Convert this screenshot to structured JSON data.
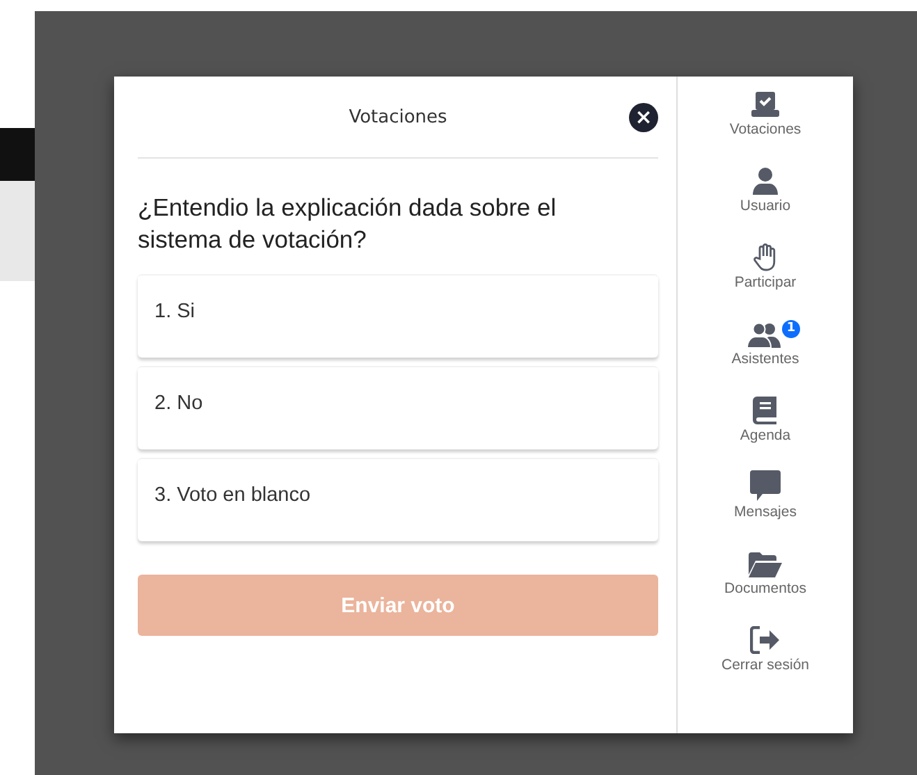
{
  "dialog": {
    "title": "Votaciones",
    "close_icon": "×"
  },
  "question": "¿Entendio la explicación dada sobre el sistema de votación?",
  "options": [
    {
      "label": "1. Si",
      "selected": false
    },
    {
      "label": "2. No",
      "selected": false
    },
    {
      "label": "3. Voto en blanco",
      "selected": false
    }
  ],
  "submit_button": {
    "label": "Enviar voto",
    "disabled": true
  },
  "sidebar": {
    "items": [
      {
        "kind": "vote",
        "label": "Votaciones"
      },
      {
        "kind": "user",
        "label": "Usuario"
      },
      {
        "kind": "hand",
        "label": "Participar"
      },
      {
        "kind": "users",
        "label": "Asistentes",
        "badge": "1"
      },
      {
        "kind": "book",
        "label": "Agenda"
      },
      {
        "kind": "message",
        "label": "Mensajes"
      },
      {
        "kind": "folder",
        "label": "Documentos"
      },
      {
        "kind": "logout",
        "label": "Cerrar sesión"
      }
    ]
  }
}
